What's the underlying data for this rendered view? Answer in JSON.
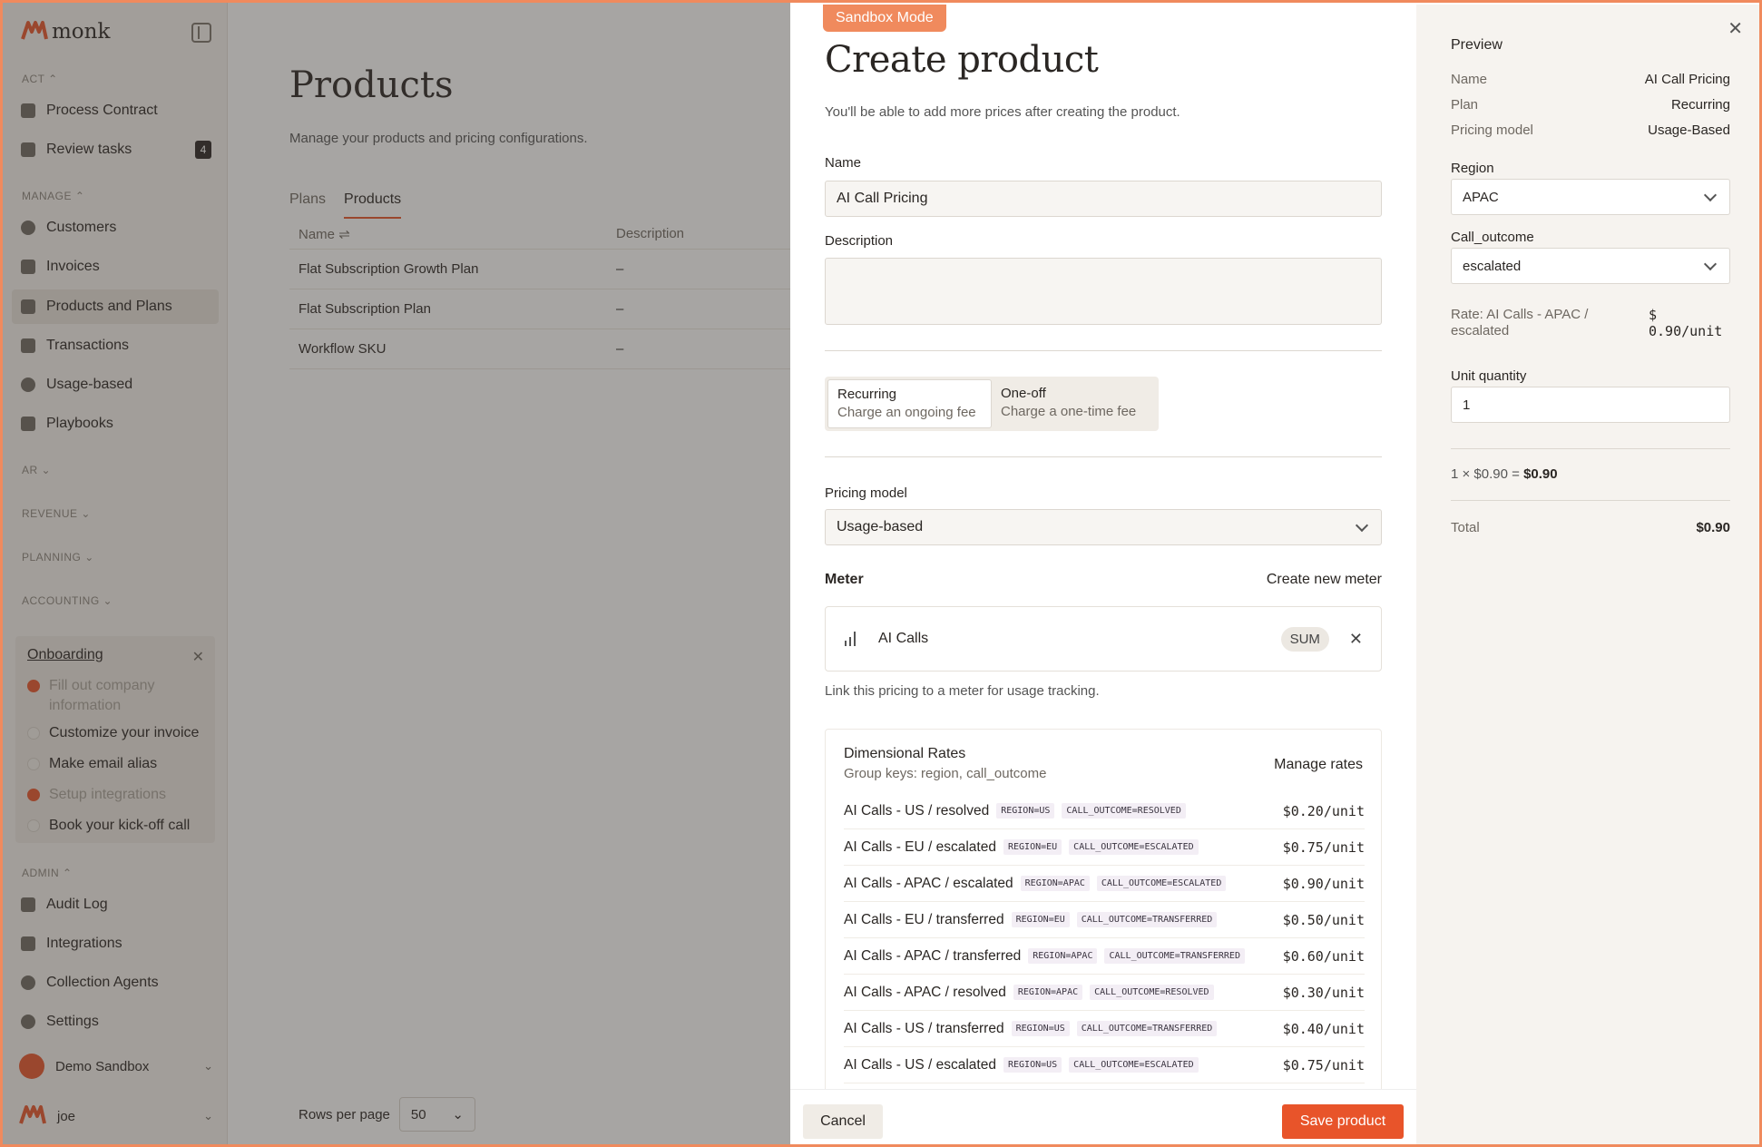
{
  "app": {
    "logo_text": "monk"
  },
  "sidebar": {
    "sections": {
      "act": "ACT",
      "manage": "MANAGE",
      "ar": "AR",
      "revenue": "REVENUE",
      "planning": "PLANNING",
      "accounting": "ACCOUNTING",
      "admin": "ADMIN"
    },
    "act_items": [
      {
        "label": "Process Contract"
      },
      {
        "label": "Review tasks",
        "count": "4"
      }
    ],
    "manage_items": [
      {
        "label": "Customers"
      },
      {
        "label": "Invoices"
      },
      {
        "label": "Products and Plans"
      },
      {
        "label": "Transactions"
      },
      {
        "label": "Usage-based"
      },
      {
        "label": "Playbooks"
      }
    ],
    "admin_items": [
      {
        "label": "Audit Log"
      },
      {
        "label": "Integrations"
      },
      {
        "label": "Collection Agents"
      },
      {
        "label": "Settings"
      }
    ],
    "onboarding": {
      "title": "Onboarding",
      "items": [
        {
          "label": "Fill out company information",
          "done": true
        },
        {
          "label": "Customize your invoice",
          "done": false
        },
        {
          "label": "Make email alias",
          "done": false
        },
        {
          "label": "Setup integrations",
          "done": true
        },
        {
          "label": "Book your kick-off call",
          "done": false
        }
      ]
    },
    "workspace": "Demo Sandbox",
    "user": "joe"
  },
  "page": {
    "title": "Products",
    "subtitle": "Manage your products and pricing configurations.",
    "tabs": [
      "Plans",
      "Products"
    ],
    "table": {
      "headers": [
        "Name",
        "Description"
      ],
      "rows": [
        [
          "Flat Subscription Growth Plan",
          "–"
        ],
        [
          "Flat Subscription Plan",
          "–"
        ],
        [
          "Workflow SKU",
          "–"
        ]
      ]
    },
    "pager": {
      "label": "Rows per page",
      "value": "50"
    }
  },
  "modal": {
    "badge": "Sandbox Mode",
    "title": "Create product",
    "subtitle": "You'll be able to add more prices after creating the product.",
    "name_label": "Name",
    "name_value": "AI Call Pricing",
    "description_label": "Description",
    "billing": {
      "options": [
        {
          "title": "Recurring",
          "desc": "Charge an ongoing fee"
        },
        {
          "title": "One-off",
          "desc": "Charge a one-time fee"
        }
      ]
    },
    "pricing_model_label": "Pricing model",
    "pricing_model_value": "Usage-based",
    "meter": {
      "label": "Meter",
      "create_link": "Create new meter",
      "name": "AI Calls",
      "aggregation": "SUM",
      "help": "Link this pricing to a meter for usage tracking."
    },
    "rates": {
      "title": "Dimensional Rates",
      "keys": "Group keys: region, call_outcome",
      "manage": "Manage rates",
      "rows": [
        {
          "name": "AI Calls - US / resolved",
          "region": "REGION=US",
          "outcome": "CALL_OUTCOME=RESOLVED",
          "price": "$0.20/unit"
        },
        {
          "name": "AI Calls - EU / escalated",
          "region": "REGION=EU",
          "outcome": "CALL_OUTCOME=ESCALATED",
          "price": "$0.75/unit"
        },
        {
          "name": "AI Calls - APAC / escalated",
          "region": "REGION=APAC",
          "outcome": "CALL_OUTCOME=ESCALATED",
          "price": "$0.90/unit"
        },
        {
          "name": "AI Calls - EU / transferred",
          "region": "REGION=EU",
          "outcome": "CALL_OUTCOME=TRANSFERRED",
          "price": "$0.50/unit"
        },
        {
          "name": "AI Calls - APAC / transferred",
          "region": "REGION=APAC",
          "outcome": "CALL_OUTCOME=TRANSFERRED",
          "price": "$0.60/unit"
        },
        {
          "name": "AI Calls - APAC / resolved",
          "region": "REGION=APAC",
          "outcome": "CALL_OUTCOME=RESOLVED",
          "price": "$0.30/unit"
        },
        {
          "name": "AI Calls - US / transferred",
          "region": "REGION=US",
          "outcome": "CALL_OUTCOME=TRANSFERRED",
          "price": "$0.40/unit"
        },
        {
          "name": "AI Calls - US / escalated",
          "region": "REGION=US",
          "outcome": "CALL_OUTCOME=ESCALATED",
          "price": "$0.75/unit"
        }
      ]
    },
    "cancel": "Cancel",
    "save": "Save product"
  },
  "preview": {
    "title": "Preview",
    "fields": [
      {
        "k": "Name",
        "v": "AI Call Pricing"
      },
      {
        "k": "Plan",
        "v": "Recurring"
      },
      {
        "k": "Pricing model",
        "v": "Usage-Based"
      }
    ],
    "region_label": "Region",
    "region_value": "APAC",
    "outcome_label": "Call_outcome",
    "outcome_value": "escalated",
    "rate_label": "Rate: AI Calls - APAC / escalated",
    "rate_value": "$ 0.90/unit",
    "qty_label": "Unit quantity",
    "qty_value": "1",
    "calc": "1 × $0.90 = ",
    "calc_result": "$0.90",
    "total_label": "Total",
    "total_value": "$0.90"
  },
  "colors": {
    "accent": "#e8542a",
    "badge": "#f08a5d",
    "sidebar_bg": "#f6f3ef"
  }
}
